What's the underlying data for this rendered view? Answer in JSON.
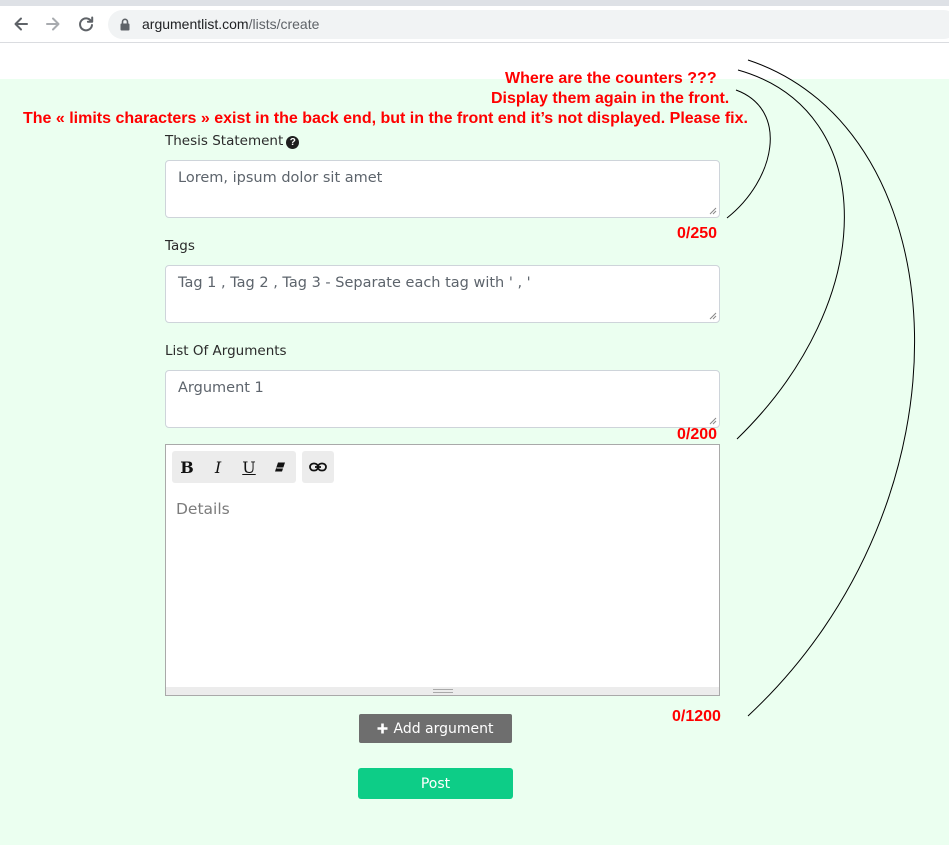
{
  "browser": {
    "url_domain": "argumentlist.com",
    "url_path": "/lists/create"
  },
  "annotations": {
    "line1": "Where are the counters ???",
    "line2": "Display them again in the front.",
    "line3": "The « limits characters » exist in the back end, but in the front end it’s not displayed. Please fix.",
    "counter_thesis": "0/250",
    "counter_argument": "0/200",
    "counter_details": "0/1200",
    "color": "#ff0000"
  },
  "form": {
    "thesis_label": "Thesis Statement",
    "thesis_placeholder": "Lorem, ipsum dolor sit amet",
    "tags_label": "Tags",
    "tags_placeholder": "Tag 1 , Tag 2 , Tag 3 - Separate each tag with ' , '",
    "arguments_label": "List Of Arguments",
    "argument_placeholder": "Argument 1",
    "details_placeholder": "Details",
    "toolbar": {
      "bold": "B",
      "italic": "I",
      "underline": "U"
    },
    "add_argument_label": "Add argument",
    "post_label": "Post"
  },
  "colors": {
    "page_background": "#ebfff0",
    "post_button": "#0dcd87",
    "add_button": "#6e6e6e"
  }
}
